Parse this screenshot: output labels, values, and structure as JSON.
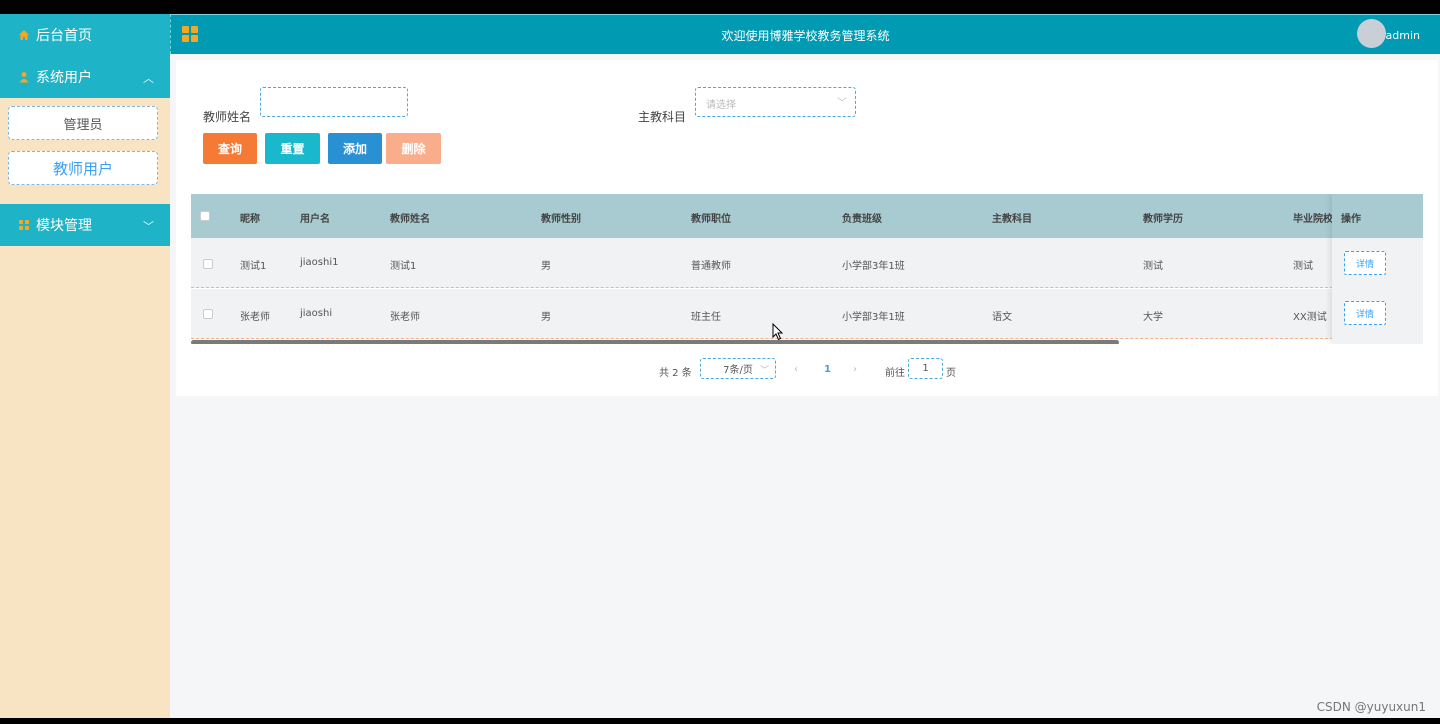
{
  "sidebar": {
    "home": {
      "label": "后台首页",
      "icon": "home-icon"
    },
    "system_users": {
      "label": "系统用户",
      "icon": "user-icon",
      "sub_items": [
        {
          "label": "管理员"
        },
        {
          "label": "教师用户"
        }
      ]
    },
    "modules": {
      "label": "模块管理",
      "icon": "grid-icon"
    }
  },
  "header": {
    "title": "欢迎使用博雅学校教务管理系统",
    "user": "admin"
  },
  "search": {
    "teacher_name_label": "教师姓名",
    "teacher_name_value": "",
    "subject_label": "主教科目",
    "subject_placeholder": "请选择"
  },
  "buttons": {
    "query": "查询",
    "reset": "重置",
    "add": "添加",
    "delete": "删除",
    "colors": {
      "query": "#f47a35",
      "reset": "#1ab8cc",
      "add": "#2a90d4",
      "delete": "#f9ad8a"
    }
  },
  "table": {
    "columns": [
      "昵称",
      "用户名",
      "教师姓名",
      "教师性别",
      "教师职位",
      "负责班级",
      "主教科目",
      "教师学历",
      "毕业院校",
      "操作"
    ],
    "rows": [
      {
        "nickname": "测试1",
        "username": "jiaoshi1",
        "teacher_name": "测试1",
        "gender": "男",
        "position": "普通教师",
        "class": "小学部3年1班",
        "subject": "",
        "education": "测试",
        "school": "测试",
        "action": "详情"
      },
      {
        "nickname": "张老师",
        "username": "jiaoshi",
        "teacher_name": "张老师",
        "gender": "男",
        "position": "班主任",
        "class": "小学部3年1班",
        "subject": "语文",
        "education": "大学",
        "school": "XX测试",
        "action": "详情"
      }
    ]
  },
  "pagination": {
    "total_text": "共 2 条",
    "page_size": "7条/页",
    "current_page": "1",
    "goto_label": "前往",
    "goto_value": "1",
    "page_unit": "页"
  },
  "watermark": "CSDN @yuyuxun1"
}
